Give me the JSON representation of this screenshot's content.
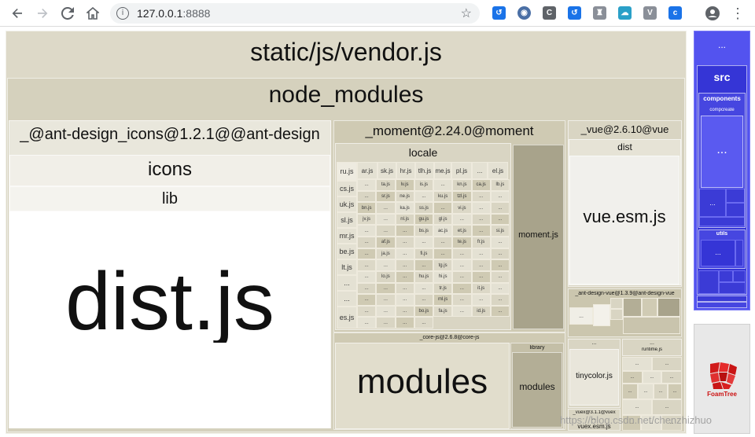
{
  "browser": {
    "url_host": "127.0.0.1",
    "url_port": ":8888",
    "info_glyph": "i",
    "star_glyph": "☆",
    "menu_glyph": "⋮",
    "ext_icons": [
      "chrome-ext-a",
      "chrome-ext-b",
      "chrome-ext-c",
      "chrome-ext-d",
      "chrome-ext-e",
      "chrome-ext-f",
      "chrome-ext-g",
      "chrome-ext-h"
    ]
  },
  "treemap": {
    "root": "static/js/vendor.js",
    "node_modules": "node_modules",
    "ant_icons": "_@ant-design_icons@1.2.1@@ant-design",
    "icons": "icons",
    "lib": "lib",
    "dist_js": "dist.js",
    "moment": "_moment@2.24.0@moment",
    "locale": "locale",
    "moment_js": "moment.js",
    "vue": "_vue@2.6.10@vue",
    "vue_dist": "dist",
    "vue_esm": "vue.esm.js",
    "antd_vue": "_ant-design-vue@1.3.9@ant-design-vue",
    "core_js": "_core-js@2.6.8@core-js",
    "modules": "modules",
    "library": "library",
    "library_modules": "modules",
    "tinycolor": "tinycolor.js",
    "runtime": "runtime.js",
    "vuex": "_vuex@3.1.1@vuex",
    "vuex_esm": "vuex.esm.js",
    "ellipsis": "...",
    "src": "src",
    "components": "components",
    "compcreate": "compcreate",
    "utils": "utils",
    "foamtree": "FoamTree",
    "watermark": "https://blog.csdn.net/chenzhizhuo",
    "locale_col1": [
      "ru.js",
      "cs.js",
      "uk.js",
      "sl.js",
      "mr.js",
      "be.js",
      "lt.js",
      "...",
      "...",
      "es.js"
    ],
    "locale_row1": [
      "ar.js",
      "sk.js",
      "hr.js",
      "tlh.js",
      "me.js",
      "pl.js",
      "...",
      "el.js"
    ],
    "locale_small": [
      "...",
      "ta.js",
      "lv.js",
      "is.js",
      "...",
      "kn.js",
      "ca.js",
      "lb.js",
      "...",
      "sr.js",
      "ne.js",
      "...",
      "ku.js",
      "tzl.js",
      "...",
      "...",
      "bn.js",
      "...",
      "ka.js",
      "ss.js",
      "...",
      "vi.js",
      "...",
      "...",
      "jv.js",
      "...",
      "nl.js",
      "gu.js",
      "gl.js",
      "...",
      "...",
      "...",
      "...",
      "...",
      "...",
      "bs.js",
      "ac.js",
      "et.js",
      "...",
      "si.js",
      "...",
      "af.js",
      "...",
      "...",
      "...",
      "te.js",
      "fr.js",
      "...",
      "...",
      "ja.js",
      "...",
      "fi.js",
      "...",
      "...",
      "...",
      "...",
      "...",
      "...",
      "...",
      "...",
      "tg.js",
      "...",
      "...",
      "...",
      "...",
      "lo.js",
      "...",
      "hu.js",
      "hi.js",
      "...",
      "...",
      "...",
      "...",
      "...",
      "...",
      "...",
      "tr.js",
      "...",
      "it.js",
      "...",
      "...",
      "...",
      "...",
      "...",
      "ml.js",
      "...",
      "...",
      "...",
      "...",
      "...",
      "...",
      "bo.js",
      "fa.js",
      "...",
      "id.js",
      "...",
      "...",
      "...",
      "...",
      "..."
    ]
  },
  "colors": {
    "root_bg": "#ddd9c8",
    "node_bg": "#d5d1bd",
    "ant_bg": "#e9e7dc",
    "dist_bg": "#ffffff",
    "moment_bg": "#cfcab3",
    "momentjs_bg": "#a8a38b",
    "vue_bg": "#d9d5c3",
    "src_bg": "#5353ef",
    "src_dark": "#2f2fc9"
  }
}
